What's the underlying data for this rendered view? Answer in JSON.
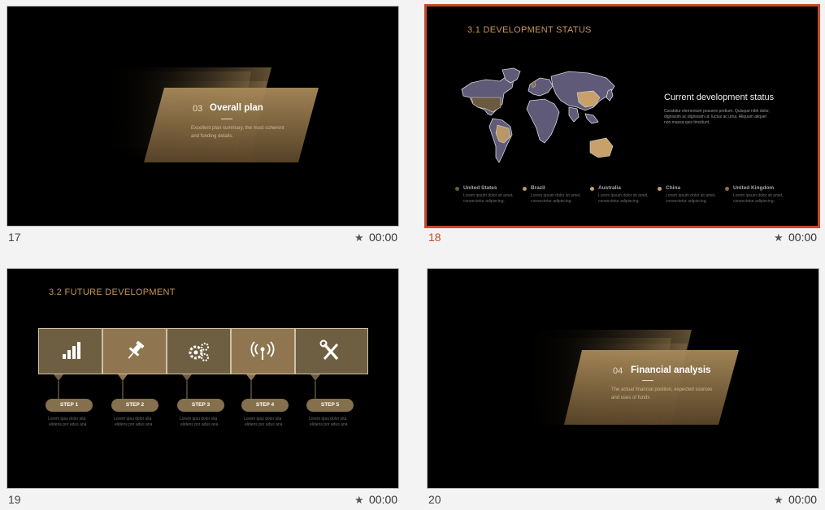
{
  "slides": [
    {
      "number": "17",
      "time": "00:00",
      "section_number": "03",
      "section_title": "Overall plan",
      "section_desc": [
        "Excellent plan summary, the most coherent",
        "and funding details."
      ]
    },
    {
      "number": "18",
      "time": "00:00",
      "selected": true,
      "title": "3.1 DEVELOPMENT STATUS",
      "subtitle": "Current development status",
      "body": [
        "Curabitur elementum posuere pretium. Quisque nibh dolor,",
        "dignissim ac dignissim ut, luctus ac urna. Aliquam aliquet",
        "non massa quis tincidunt."
      ],
      "legend": [
        {
          "name": "United States",
          "desc": [
            "Lorem ipsum dolor sit amet,",
            "consectetur adipiscing."
          ],
          "color": "#6b5a3e"
        },
        {
          "name": "Brazil",
          "desc": [
            "Lorem ipsum dolor sit amet,",
            "consectetur adipiscing."
          ],
          "color": "#b89866"
        },
        {
          "name": "Australia",
          "desc": [
            "Lorem ipsum dolor sit amet,",
            "consectetur adipiscing."
          ],
          "color": "#c7a06a"
        },
        {
          "name": "China",
          "desc": [
            "Lorem ipsum dolor sit amet,",
            "consectetur adipiscing."
          ],
          "color": "#c7a06a"
        },
        {
          "name": "United Kingdom",
          "desc": [
            "Lorem ipsum dolor sit amet,",
            "consectetur adipiscing."
          ],
          "color": "#8a6f49"
        }
      ]
    },
    {
      "number": "19",
      "time": "00:00",
      "title": "3.2 FUTURE DEVELOPMENT",
      "steps": [
        {
          "label": "STEP 1",
          "icon": "bar-chart-icon",
          "desc": [
            "Lorem ipsu dolor sita",
            "elidens por adus ana"
          ]
        },
        {
          "label": "STEP 2",
          "icon": "pushpin-icon",
          "desc": [
            "Lorem ipsu dolor sita",
            "elidens por adus ana"
          ]
        },
        {
          "label": "STEP 3",
          "icon": "gears-icon",
          "desc": [
            "Lorem ipsu dolor sita",
            "elidens por adus ana"
          ]
        },
        {
          "label": "STEP 4",
          "icon": "broadcast-icon",
          "desc": [
            "Lorem ipsu dolor sita",
            "elidens por adus ana"
          ]
        },
        {
          "label": "STEP 5",
          "icon": "tools-icon",
          "desc": [
            "Lorem ipsu dolor sita",
            "elidens por adus ana"
          ]
        }
      ]
    },
    {
      "number": "20",
      "time": "00:00",
      "section_number": "04",
      "section_title": "Financial analysis",
      "section_desc": [
        "The actual financial position, expected sources",
        "and uses of funds"
      ]
    }
  ],
  "colors": {
    "selection": "#c64a2b",
    "gold": "#c8965a",
    "map_land": "#5e5a78",
    "box_dark": "#6f5f42",
    "box_light": "#8f7650"
  }
}
